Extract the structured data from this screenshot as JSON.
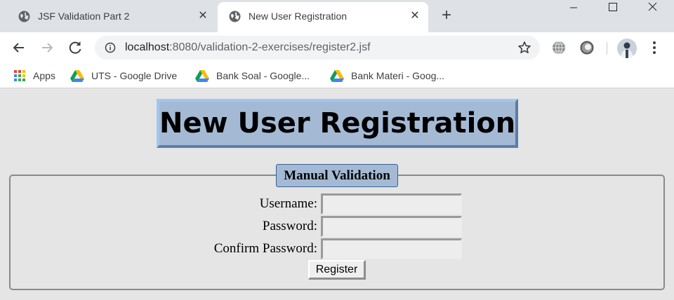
{
  "browser": {
    "tabs": [
      {
        "title": "JSF Validation Part 2",
        "active": false,
        "icon": "globe-icon"
      },
      {
        "title": "New User Registration",
        "active": true,
        "icon": "globe-icon"
      }
    ],
    "new_tab_icon": "plus-icon",
    "window_controls": [
      "minimize-icon",
      "maximize-icon",
      "close-icon"
    ]
  },
  "toolbar": {
    "url_host": "localhost",
    "url_rest": ":8080/validation-2-exercises/register2.jsf",
    "icons": [
      "back-arrow-icon",
      "forward-arrow-icon",
      "reload-icon",
      "info-icon",
      "star-icon",
      "globe-extension-icon",
      "ring-extension-icon",
      "avatar",
      "more-menu-icon"
    ]
  },
  "bookmarks": {
    "apps_label": "Apps",
    "items": [
      {
        "label": "UTS - Google Drive",
        "icon": "google-drive-icon"
      },
      {
        "label": "Bank Soal - Google...",
        "icon": "google-drive-icon"
      },
      {
        "label": "Bank Materi - Goog...",
        "icon": "google-drive-icon"
      }
    ]
  },
  "page": {
    "heading": "New User Registration",
    "form": {
      "legend": "Manual Validation",
      "fields": [
        {
          "label": "Username:",
          "value": ""
        },
        {
          "label": "Password:",
          "value": ""
        },
        {
          "label": "Confirm Password:",
          "value": ""
        }
      ],
      "submit_label": "Register"
    }
  },
  "colors": {
    "tab_strip": "#dee1e6",
    "heading_bg": "#a4bad4",
    "page_bg": "#e5e5e5",
    "legend_border": "#3a5f95"
  }
}
